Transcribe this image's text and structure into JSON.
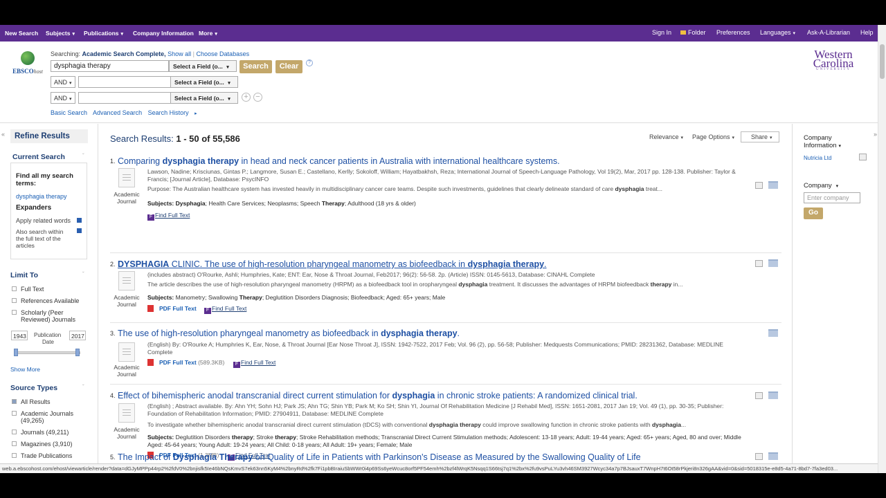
{
  "topbar": {
    "left": [
      "New Search",
      "Subjects",
      "Publications",
      "Company Information",
      "More"
    ],
    "right": [
      "Sign In",
      "Folder",
      "Preferences",
      "Languages",
      "Ask-A-Librarian",
      "Help"
    ]
  },
  "logo": {
    "brand": "EBSCO",
    "suffix": "host"
  },
  "search": {
    "searching_label": "Searching:",
    "database": "Academic Search Complete,",
    "show_all": "Show all",
    "choose_db": "Choose Databases",
    "query": "dysphagia therapy",
    "field_label": "Select a Field (o...",
    "bool": "AND",
    "search_btn": "Search",
    "clear_btn": "Clear",
    "help": "?",
    "basic": "Basic Search",
    "advanced": "Advanced Search",
    "history": "Search History"
  },
  "univ": {
    "line1": "Western",
    "line2": "Carolina",
    "line3": "UNIVERSITY"
  },
  "left": {
    "refine": "Refine Results",
    "current_search": "Current Search",
    "find_all": "Find all my search terms:",
    "term": "dysphagia therapy",
    "expanders": "Expanders",
    "apply_related": "Apply related words",
    "also_search": [
      "Also search within",
      "the full text of the",
      "articles"
    ],
    "limit_to": "Limit To",
    "full_text": "Full Text",
    "refs": "References Available",
    "scholarly": [
      "Scholarly (Peer",
      "Reviewed) Journals"
    ],
    "date_from": "1943",
    "date_to": "2017",
    "pub_date": [
      "Publication",
      "Date"
    ],
    "show_more": "Show More",
    "source_types": "Source Types",
    "sources": [
      "All Results",
      "Academic Journals",
      "(49,265)",
      "Journals (49,211)",
      "Magazines (3,910)",
      "Trade Publications"
    ]
  },
  "main": {
    "results_label": "Search Results:",
    "results_range": "1 - 50 of 55,586",
    "relevance": "Relevance",
    "page_options": "Page Options",
    "share": "Share",
    "records": [
      {
        "num": "1.",
        "title_parts": [
          "Comparing ",
          "dysphagia therapy",
          " in head and neck cancer patients in Australia with international healthcare systems."
        ],
        "type": [
          "Academic",
          "Journal"
        ],
        "meta1": "Lawson, Nadine; Krisciunas, Gintas P.; Langmore, Susan E.; Castellano, Kerlly; Sokoloff, William; Hayatbakhsh, Reza; International Journal of Speech-Language Pathology, Vol 19(2), Mar, 2017 pp. 128-138. Publisher: Taylor &",
        "meta2": "Francis; [Journal Article], Database: PsycINFO",
        "abstract_parts": [
          "Purpose: The Australian healthcare system has invested heavily in multidisciplinary cancer care teams. Despite such investments, guidelines that clearly delineate standard of care ",
          "dysphagia",
          " treat..."
        ],
        "subjects_parts": [
          "Subjects: ",
          "Dysphagia",
          "; Health Care Services; Neoplasms; Speech ",
          "Therapy",
          "; Adulthood (18 yrs & older)"
        ],
        "findft": "Find Full Text"
      },
      {
        "num": "2.",
        "title_parts": [
          "DYSPHAGIA",
          " CLINIC. The use of high-resolution pharyngeal manometry as biofeedback in ",
          "dysphagia therapy",
          "."
        ],
        "type": [
          "Academic",
          "Journal"
        ],
        "meta1": "(includes abstract) O'Rourke, Ashli; Humphries, Kate; ENT: Ear, Nose & Throat Journal, Feb2017; 96(2): 56-58. 2p. (Article) ISSN: 0145-5613, Database: CINAHL Complete",
        "abstract_parts": [
          "The article describes the use of high-resolution pharyngeal manometry (HRPM) as a biofeedback tool in oropharyngeal ",
          "dysphagia",
          " treatment. It discusses the advantages of HRPM biofeedback ",
          "therapy",
          " in..."
        ],
        "subjects_parts": [
          "Subjects: ",
          "Manometry; Swallowing ",
          "Therapy",
          "; Deglutition Disorders Diagnosis; Biofeedback; Aged: 65+ years; Male"
        ],
        "pdf": "PDF Full Text",
        "findft": "Find Full Text"
      },
      {
        "num": "3.",
        "title_parts": [
          "The use of high-resolution pharyngeal manometry as biofeedback in ",
          "dysphagia therapy",
          "."
        ],
        "type": [
          "Academic",
          "Journal"
        ],
        "meta1": "(English) By: O'Rourke A; Humphries K, Ear, Nose, & Throat Journal [Ear Nose Throat J], ISSN: 1942-7522, 2017 Feb; Vol. 96 (2), pp. 56-58; Publisher: Medquests Communications; PMID: 28231362, Database: MEDLINE",
        "meta2": "Complete",
        "pdf": "PDF Full Text",
        "pdf_size": "(589.3KB)",
        "findft": "Find Full Text"
      },
      {
        "num": "4.",
        "title_parts": [
          "Effect of bihemispheric anodal transcranial direct current stimulation for ",
          "dysphagia",
          " in chronic stroke patients: A randomized clinical trial."
        ],
        "type": [
          "Academic",
          "Journal"
        ],
        "meta1": "(English) ; Abstract available. By: Ahn YH; Sohn HJ; Park JS; Ahn TG; Shin YB; Park M; Ko SH; Shin YI, Journal Of Rehabilitation Medicine [J Rehabil Med], ISSN: 1651-2081, 2017 Jan 19; Vol. 49 (1), pp. 30-35; Publisher:",
        "meta2": "Foundation of Rehabilitation Information; PMID: 27904911, Database: MEDLINE Complete",
        "abstract_parts": [
          "To investigate whether bihemispheric anodal transcranial direct current stimulation (tDCS) with conventional ",
          "dysphagia therapy",
          " could improve swallowing function in chronic stroke patients with ",
          "dysphagia",
          "..."
        ],
        "subjects_parts": [
          "Subjects: ",
          "Deglutition Disorders ",
          "therapy",
          "; Stroke ",
          "therapy",
          "; Stroke Rehabilitation methods; Transcranial Direct Current Stimulation methods; Adolescent: 13-18 years; Adult: 19-44 years; Aged: 65+ years; Aged, 80 and over; Middle"
        ],
        "subjects2": "Aged: 45-64 years; Young Adult: 19-24 years; All Child: 0-18 years; All Adult: 19+ years; Female; Male",
        "pdf": "PDF Full Text",
        "pdf_size": "(1.3MB)",
        "findft": "Find Full Text"
      },
      {
        "num": "5.",
        "title_parts": [
          "The Impact of ",
          "Dysphagia Therapy",
          " on Quality of Life in Patients with Parkinson's Disease as Measured by the Swallowing Quality of Life"
        ]
      }
    ]
  },
  "right": {
    "company_info": [
      "Company",
      "Information"
    ],
    "nutricia": "Nutricia Ltd",
    "company": "Company",
    "enter_company": "Enter company",
    "go": "Go"
  },
  "status_url": "web.a.ebscohost.com/ehost/viewarticle/render?data=dGJyMPPp44rp2%2fdV0%2bnjisfk5Ie46bNQsKmvS7ek63nn5KyM4%2bnyRd%2fk7Fi1pbBIraiuSbWWr0i4p69Ss6yeWcuc8orf5PF54emh%2bzf4lWrqK5Nsqq1S66tsj7q1%2bx%2fu9vsPuLYu3vh46SM3927Wcyc34a7p7BJsauxT7WnpH7t6Ot58rPkjeri8n326gAA&vid=0&sid=5018315e-e8d5-4a71-8bd7-7fa3ed03..."
}
